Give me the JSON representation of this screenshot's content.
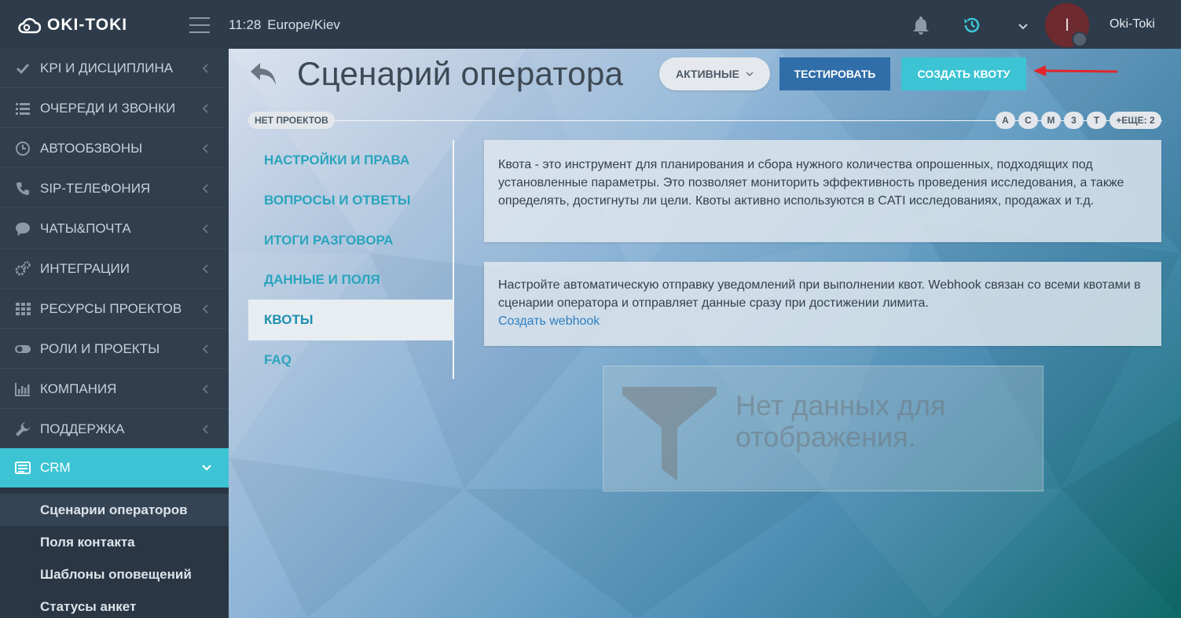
{
  "header": {
    "logo_text": "OKI-TOKI",
    "time": "11:28",
    "timezone": "Europe/Kiev",
    "avatar_letter": "I",
    "username": "Oki-Toki"
  },
  "sidebar": {
    "items": [
      {
        "label": "KPI И ДИСЦИПЛИНА",
        "icon": "check-icon"
      },
      {
        "label": "ОЧЕРЕДИ И ЗВОНКИ",
        "icon": "list-icon"
      },
      {
        "label": "АВТООБЗВОНЫ",
        "icon": "clock-icon"
      },
      {
        "label": "SIP-ТЕЛЕФОНИЯ",
        "icon": "phone-icon"
      },
      {
        "label": "ЧАТЫ&ПОЧТА",
        "icon": "chat-icon"
      },
      {
        "label": "ИНТЕГРАЦИИ",
        "icon": "gears-icon"
      },
      {
        "label": "РЕСУРСЫ ПРОЕКТОВ",
        "icon": "grid-icon"
      },
      {
        "label": "РОЛИ И ПРОЕКТЫ",
        "icon": "toggle-icon"
      },
      {
        "label": "КОМПАНИЯ",
        "icon": "bar-chart-icon"
      },
      {
        "label": "ПОДДЕРЖКА",
        "icon": "wrench-icon"
      },
      {
        "label": "CRM",
        "icon": "crm-icon"
      }
    ],
    "subitems": [
      {
        "label": "Сценарии операторов"
      },
      {
        "label": "Поля контакта"
      },
      {
        "label": "Шаблоны оповещений"
      },
      {
        "label": "Статусы анкет"
      }
    ]
  },
  "main": {
    "title": "Сценарий оператора",
    "filter_label": "АКТИВНЫЕ",
    "test_button": "ТЕСТИРОВАТЬ",
    "create_quota_button": "СОЗДАТЬ КВОТУ",
    "projects_badge": "НЕТ ПРОЕКТОВ",
    "chips": [
      "A",
      "C",
      "M",
      "3",
      "T"
    ],
    "chips_more": "+ЕЩЕ: 2",
    "tabs": [
      {
        "label": "НАСТРОЙКИ И ПРАВА"
      },
      {
        "label": "ВОПРОСЫ И ОТВЕТЫ"
      },
      {
        "label": "ИТОГИ РАЗГОВОРА"
      },
      {
        "label": "ДАННЫЕ И ПОЛЯ"
      },
      {
        "label": "КВОТЫ"
      },
      {
        "label": "FAQ"
      }
    ],
    "info_text": "Квота - это инструмент для планирования и сбора нужного количества опрошенных, подходящих под установленные параметры. Это позволяет мониторить эффективность проведения исследования, а также определять, достигнуты ли цели. Квоты активно используются в CATI исследованиях, продажах и т.д.",
    "webhook_text": "Настройте автоматическую отправку уведомлений при выполнении квот. Webhook связан со всеми квотами в сценарии оператора и отправляет данные сразу при достижении лимита.",
    "webhook_link": "Создать webhook",
    "empty_line1": "Нет данных для",
    "empty_line2": "отображения."
  },
  "colors": {
    "accent": "#3cc4d4",
    "primary": "#2f6ea9",
    "sidebar": "#303e4d",
    "topbar": "#2e3b4a",
    "arrow": "#e0262b"
  }
}
